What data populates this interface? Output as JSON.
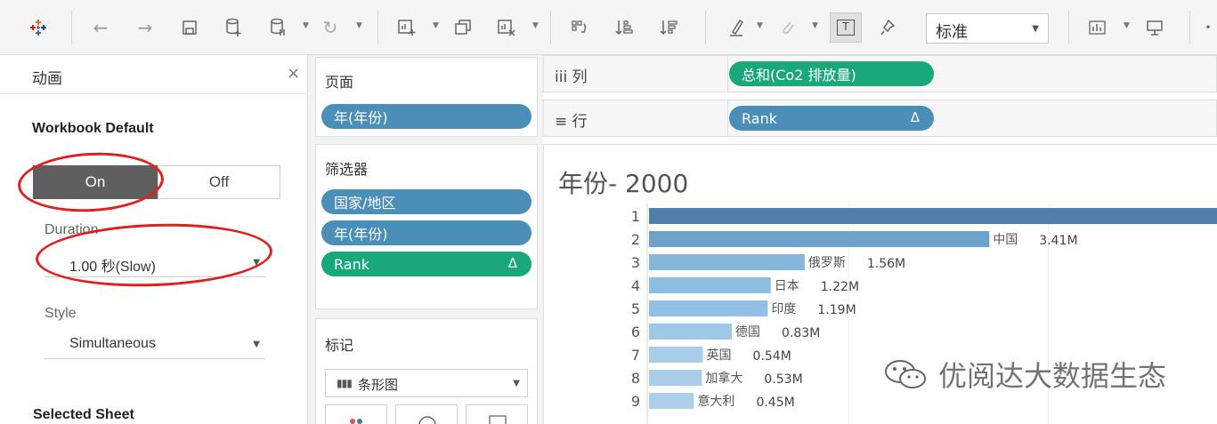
{
  "toolbar": {
    "style_select": {
      "value": "标准"
    }
  },
  "animation_panel": {
    "title": "动画",
    "close": "×",
    "section_title": "Workbook Default",
    "toggle": {
      "on_label": "On",
      "off_label": "Off",
      "selected": "On"
    },
    "duration_label": "Duration",
    "duration_value": "1.00 秒(Slow)",
    "style_label": "Style",
    "style_value": "Simultaneous",
    "selected_sheet_label": "Selected Sheet"
  },
  "pages_card": {
    "title": "页面",
    "pills": [
      {
        "label": "年(年份)"
      }
    ]
  },
  "filters_card": {
    "title": "筛选器",
    "pills": [
      {
        "label": "国家/地区"
      },
      {
        "label": "年(年份)"
      },
      {
        "label": "Rank",
        "delta": "Δ"
      }
    ]
  },
  "marks_card": {
    "title": "标记",
    "type_value": "条形图",
    "type_icon": "bar-chart-icon"
  },
  "columns_shelf": {
    "label": "iii 列",
    "pill": "总和(Co2 排放量)"
  },
  "rows_shelf": {
    "label": "≡ 行",
    "pill": "Rank",
    "delta": "Δ"
  },
  "viz": {
    "title": "年份- 2000"
  },
  "chart_data": {
    "type": "bar",
    "orientation": "horizontal",
    "categories": [
      "1",
      "2",
      "3",
      "4",
      "5",
      "6",
      "7",
      "8",
      "9"
    ],
    "category_labels": [
      "",
      "中国",
      "俄罗斯",
      "日本",
      "印度",
      "德国",
      "英国",
      "加拿大",
      "意大利"
    ],
    "value_labels": [
      "",
      "3.41M",
      "1.56M",
      "1.22M",
      "1.19M",
      "0.83M",
      "0.54M",
      "0.53M",
      "0.45M"
    ],
    "values": [
      5.7,
      3.41,
      1.56,
      1.22,
      1.19,
      0.83,
      0.54,
      0.53,
      0.45
    ],
    "xlim": [
      0,
      5.7
    ],
    "colors": [
      "#4f80ad",
      "#6ea2cb",
      "#86b6dc",
      "#8fbde2",
      "#92bfe3",
      "#9fc7e6",
      "#a8cdea",
      "#a9ceea",
      "#acd0eb"
    ],
    "grid": true
  },
  "watermark": {
    "text": "优阅达大数据生态"
  },
  "colors": {
    "accent_green": "#19a879",
    "pill_blue": "#4b8fb8",
    "annotation_red": "#e02020",
    "toggle_on": "#5f5f5f"
  }
}
